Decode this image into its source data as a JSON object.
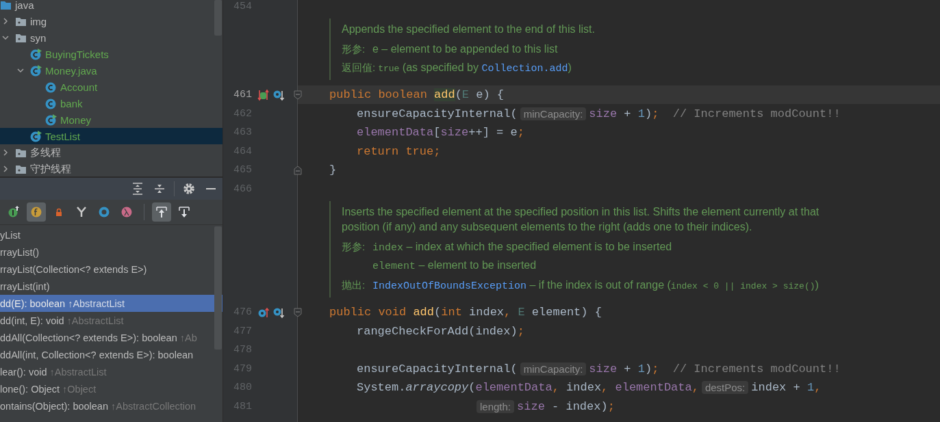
{
  "project_tree": {
    "items": [
      {
        "label": "java",
        "kind": "source_root",
        "selected": false,
        "children": [
          {
            "label": "img",
            "kind": "package",
            "expanded": false,
            "selected": false
          },
          {
            "label": "syn",
            "kind": "package",
            "expanded": true,
            "selected": false,
            "children": [
              {
                "label": "BuyingTickets",
                "kind": "class",
                "runnable": true,
                "selected": false
              },
              {
                "label": "Money.java",
                "kind": "class",
                "runnable": true,
                "expanded": true,
                "selected": false,
                "children": [
                  {
                    "label": "Account",
                    "kind": "class",
                    "runnable": false,
                    "selected": false
                  },
                  {
                    "label": "bank",
                    "kind": "class",
                    "runnable": false,
                    "selected": false
                  },
                  {
                    "label": "Money",
                    "kind": "class",
                    "runnable": true,
                    "selected": false
                  }
                ]
              },
              {
                "label": "TestList",
                "kind": "class",
                "runnable": true,
                "selected": true
              }
            ]
          },
          {
            "label": "多线程",
            "kind": "package",
            "expanded": false,
            "selected": false
          },
          {
            "label": "守护线程",
            "kind": "package",
            "expanded": false,
            "selected": false
          }
        ]
      }
    ]
  },
  "structure_panel": {
    "filters": [
      {
        "kind": "inherited",
        "selected": false
      },
      {
        "kind": "fields",
        "selected": true
      },
      {
        "kind": "non_public",
        "selected": false
      },
      {
        "kind": "hierarchy",
        "selected": false
      },
      {
        "kind": "anonymous",
        "selected": false
      },
      {
        "kind": "lambdas",
        "selected": false
      }
    ],
    "navigation": [
      {
        "kind": "scroll_to_source",
        "selected": true
      },
      {
        "kind": "scroll_from_source",
        "selected": false
      }
    ],
    "members": [
      {
        "name": "yList",
        "selected": false
      },
      {
        "name": "rrayList()",
        "selected": false
      },
      {
        "name": "rrayList(Collection<? extends E>)",
        "selected": false
      },
      {
        "name": "rrayList(int)",
        "selected": false
      },
      {
        "name": "dd(E): boolean",
        "origin": "↑AbstractList",
        "selected": true
      },
      {
        "name": "dd(int, E): void",
        "origin": "↑AbstractList",
        "selected": false
      },
      {
        "name": "ddAll(Collection<? extends E>): boolean",
        "origin": "↑Ab",
        "selected": false
      },
      {
        "name": "ddAll(int, Collection<? extends E>): boolean",
        "selected": false
      },
      {
        "name": "lear(): void",
        "origin": "↑AbstractList",
        "selected": false
      },
      {
        "name": "lone(): Object",
        "origin": "↑Object",
        "selected": false
      },
      {
        "name": "ontains(Object): boolean",
        "origin": "↑AbstractCollection",
        "selected": false
      }
    ]
  },
  "editor": {
    "rows": [
      {
        "kind": "blank",
        "number": "454",
        "highlighted": false,
        "fold_start": false,
        "fold_end": false
      },
      {
        "kind": "doc",
        "description": [
          "Appends the specified element to the end of this list."
        ],
        "sections": [
          {
            "label": "形参:",
            "lines": [
              [
                {
                  "kind": "text",
                  "text": "e – element to be appended to this list"
                }
              ]
            ]
          },
          {
            "label": "返回值:",
            "lines": [
              [
                {
                  "kind": "small_code",
                  "text": "true"
                },
                {
                  "kind": "text",
                  "text": " (as specified by "
                },
                {
                  "kind": "link",
                  "text": "Collection.add"
                },
                {
                  "kind": "text",
                  "text": ")"
                }
              ]
            ]
          }
        ]
      },
      {
        "kind": "method",
        "number": "461",
        "highlighted": true,
        "fold_start": true,
        "fold_end": false,
        "gutter_icons": [
          {
            "kind": "implemented_overridden"
          },
          {
            "kind": "overridden"
          }
        ],
        "tokens": [
          {
            "kind": "keyword",
            "text": "public "
          },
          {
            "kind": "keyword",
            "text": "boolean "
          },
          {
            "kind": "decl_hl",
            "text": "add"
          },
          {
            "kind": "plain",
            "text": "("
          },
          {
            "kind": "typeparam",
            "text": "E"
          },
          {
            "kind": "plain",
            "text": " e) {"
          }
        ]
      },
      {
        "kind": "body",
        "number": "462",
        "highlighted": false,
        "fold_start": false,
        "fold_end": false,
        "tokens": [
          {
            "kind": "plain",
            "text": "ensureCapacityInternal("
          },
          {
            "kind": "hint",
            "text": "minCapacity:"
          },
          {
            "kind": "field",
            "text": "size"
          },
          {
            "kind": "plain",
            "text": " + "
          },
          {
            "kind": "number",
            "text": "1"
          },
          {
            "kind": "plain",
            "text": ")"
          },
          {
            "kind": "semi",
            "text": ";"
          },
          {
            "kind": "comment",
            "text": "// Increments modCount!!"
          }
        ]
      },
      {
        "kind": "body",
        "number": "463",
        "highlighted": false,
        "fold_start": false,
        "fold_end": false,
        "tokens": [
          {
            "kind": "field",
            "text": "elementData"
          },
          {
            "kind": "plain",
            "text": "["
          },
          {
            "kind": "field",
            "text": "size"
          },
          {
            "kind": "plain",
            "text": "++] = e"
          },
          {
            "kind": "semi",
            "text": ";"
          }
        ]
      },
      {
        "kind": "body",
        "number": "464",
        "highlighted": false,
        "fold_start": false,
        "fold_end": false,
        "tokens": [
          {
            "kind": "keyword",
            "text": "return true"
          },
          {
            "kind": "semi",
            "text": ";"
          }
        ]
      },
      {
        "kind": "method",
        "number": "465",
        "highlighted": false,
        "fold_start": false,
        "fold_end": true,
        "tokens": [
          {
            "kind": "plain",
            "text": "}"
          }
        ]
      },
      {
        "kind": "blank",
        "number": "466",
        "highlighted": false,
        "fold_start": false,
        "fold_end": false
      },
      {
        "kind": "doc",
        "description": [
          "Inserts the specified element at the specified position in this list. Shifts the element currently at that",
          "position (if any) and any subsequent elements to the right (adds one to their indices)."
        ],
        "sections": [
          {
            "label": "形参:",
            "lines": [
              [
                {
                  "kind": "code",
                  "text": "index"
                },
                {
                  "kind": "text",
                  "text": " – index at which the specified element is to be inserted"
                }
              ],
              [
                {
                  "kind": "code",
                  "text": "element"
                },
                {
                  "kind": "text",
                  "text": " – element to be inserted"
                }
              ]
            ]
          },
          {
            "label": "抛出:",
            "lines": [
              [
                {
                  "kind": "link",
                  "text": "IndexOutOfBoundsException"
                },
                {
                  "kind": "text",
                  "text": " – if the index is out of range ("
                },
                {
                  "kind": "small_code",
                  "text": "index < 0 || index > size()"
                },
                {
                  "kind": "text",
                  "text": ")"
                }
              ]
            ]
          }
        ]
      },
      {
        "kind": "method",
        "number": "476",
        "highlighted": false,
        "fold_start": true,
        "fold_end": false,
        "gutter_icons": [
          {
            "kind": "overrides"
          },
          {
            "kind": "overridden"
          }
        ],
        "tokens": [
          {
            "kind": "keyword",
            "text": "public void "
          },
          {
            "kind": "decl",
            "text": "add"
          },
          {
            "kind": "plain",
            "text": "("
          },
          {
            "kind": "keyword",
            "text": "int"
          },
          {
            "kind": "plain",
            "text": " index"
          },
          {
            "kind": "semi",
            "text": ","
          },
          {
            "kind": "typeparam",
            "text": " E"
          },
          {
            "kind": "plain",
            "text": " element) {"
          }
        ]
      },
      {
        "kind": "body",
        "number": "477",
        "highlighted": false,
        "fold_start": false,
        "fold_end": false,
        "tokens": [
          {
            "kind": "plain",
            "text": "rangeCheckForAdd(index)"
          },
          {
            "kind": "semi",
            "text": ";"
          }
        ]
      },
      {
        "kind": "blank",
        "number": "478",
        "highlighted": false,
        "fold_start": false,
        "fold_end": false
      },
      {
        "kind": "body",
        "number": "479",
        "highlighted": false,
        "fold_start": false,
        "fold_end": false,
        "tokens": [
          {
            "kind": "plain",
            "text": "ensureCapacityInternal("
          },
          {
            "kind": "hint",
            "text": "minCapacity:"
          },
          {
            "kind": "field",
            "text": "size"
          },
          {
            "kind": "plain",
            "text": " + "
          },
          {
            "kind": "number",
            "text": "1"
          },
          {
            "kind": "plain",
            "text": ")"
          },
          {
            "kind": "semi",
            "text": ";"
          },
          {
            "kind": "comment",
            "text": "// Increments modCount!!"
          }
        ]
      },
      {
        "kind": "body",
        "number": "480",
        "highlighted": false,
        "fold_start": false,
        "fold_end": false,
        "tokens": [
          {
            "kind": "plain",
            "text": "System."
          },
          {
            "kind": "static",
            "text": "arraycopy"
          },
          {
            "kind": "plain",
            "text": "("
          },
          {
            "kind": "field",
            "text": "elementData"
          },
          {
            "kind": "semi",
            "text": ","
          },
          {
            "kind": "plain",
            "text": " index"
          },
          {
            "kind": "semi",
            "text": ","
          },
          {
            "kind": "field",
            "text": " elementData"
          },
          {
            "kind": "semi",
            "text": ","
          },
          {
            "kind": "hint",
            "text": "destPos:"
          },
          {
            "kind": "plain",
            "text": "index + "
          },
          {
            "kind": "number",
            "text": "1"
          },
          {
            "kind": "semi",
            "text": ","
          }
        ]
      },
      {
        "kind": "wrap",
        "number": "481",
        "highlighted": false,
        "fold_start": false,
        "fold_end": false,
        "tokens": [
          {
            "kind": "hint",
            "text": "length:"
          },
          {
            "kind": "field",
            "text": "size"
          },
          {
            "kind": "plain",
            "text": " - index)"
          },
          {
            "kind": "semi",
            "text": ";"
          }
        ]
      }
    ]
  }
}
